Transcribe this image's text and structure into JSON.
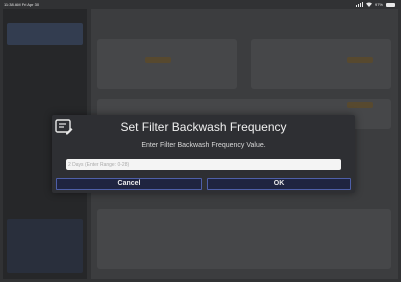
{
  "status_bar": {
    "time_date": "11:38 AM  Fri Apr 30",
    "battery": "97%"
  },
  "dialog": {
    "icon": "edit-note-icon",
    "title": "Set Filter Backwash Frequency",
    "message": "Enter Filter Backwash Frequency Value.",
    "input": {
      "value": "",
      "placeholder": "2 Days (Enter Range: 0-28)"
    },
    "buttons": {
      "cancel": "Cancel",
      "ok": "OK"
    }
  },
  "colors": {
    "button_border": "#4e5fa8",
    "dialog_bg": "#2e2f33"
  }
}
